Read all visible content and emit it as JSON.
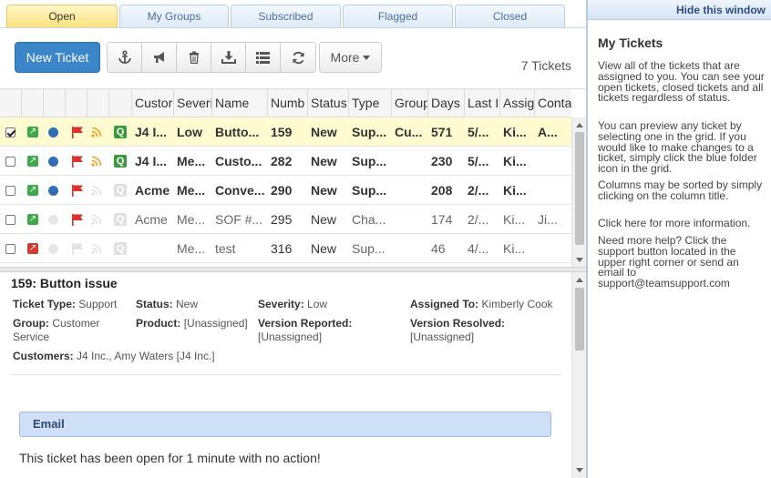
{
  "tabs": [
    {
      "label": "Open",
      "active": true
    },
    {
      "label": "My Groups",
      "active": false
    },
    {
      "label": "Subscribed",
      "active": false
    },
    {
      "label": "Flagged",
      "active": false
    },
    {
      "label": "Closed",
      "active": false
    }
  ],
  "toolbar": {
    "new_ticket_label": "New Ticket",
    "icons": [
      "anchor-icon",
      "megaphone-icon",
      "trash-icon",
      "download-icon",
      "list-icon",
      "refresh-icon"
    ],
    "more_label": "More",
    "ticket_count": "7 Tickets"
  },
  "grid": {
    "headers": [
      "Custor",
      "Severi",
      "Name",
      "Numb",
      "Status",
      "Type",
      "Group",
      "Days",
      "Last I",
      "Assig",
      "Conta"
    ],
    "rows": [
      {
        "checked": true,
        "dot": "blue",
        "flag": true,
        "rss_active": true,
        "q_active": true,
        "arrow": "green",
        "bold": true,
        "cells": [
          "J4 I...",
          "Low",
          "Butto...",
          "159",
          "New",
          "Sup...",
          "Cu...",
          "571",
          "5/...",
          "Ki...",
          "A..."
        ]
      },
      {
        "checked": false,
        "dot": "blue",
        "flag": true,
        "rss_active": true,
        "q_active": true,
        "arrow": "green",
        "bold": true,
        "cells": [
          "J4 I...",
          "Me...",
          "Custo...",
          "282",
          "New",
          "Sup...",
          "",
          "230",
          "5/...",
          "Ki...",
          ""
        ]
      },
      {
        "checked": false,
        "dot": "blue",
        "flag": true,
        "rss_active": false,
        "q_active": false,
        "arrow": "green",
        "bold": true,
        "cells": [
          "Acme",
          "Me...",
          "Conve...",
          "290",
          "New",
          "Sup...",
          "",
          "208",
          "2/...",
          "Ki...",
          ""
        ]
      },
      {
        "checked": false,
        "dot": "off",
        "flag": true,
        "rss_active": false,
        "q_active": false,
        "arrow": "green",
        "bold": false,
        "cells": [
          "Acme",
          "Me...",
          "SOF #...",
          "295",
          "New",
          "Cha...",
          "",
          "174",
          "2/...",
          "Ki...",
          "Ji..."
        ]
      },
      {
        "checked": false,
        "dot": "off",
        "flag": false,
        "rss_active": false,
        "q_active": false,
        "arrow": "red",
        "bold": false,
        "cells": [
          "",
          "Me...",
          "test",
          "316",
          "New",
          "Sup...",
          "",
          "46",
          "4/...",
          "Ki...",
          ""
        ]
      }
    ]
  },
  "detail": {
    "title": "159: Button issue",
    "ticket_type_label": "Ticket Type:",
    "ticket_type": "Support",
    "status_label": "Status:",
    "status": "New",
    "severity_label": "Severity:",
    "severity": "Low",
    "assigned_label": "Assigned To:",
    "assigned": "Kimberly Cook",
    "group_label": "Group:",
    "group_line1": "Customer",
    "group_line2": "Service",
    "product_label": "Product:",
    "product": "[Unassigned]",
    "version_reported_label": "Version Reported:",
    "version_reported": "[Unassigned]",
    "version_resolved_label": "Version Resolved:",
    "version_resolved": "[Unassigned]",
    "customers_label": "Customers:",
    "customers": "J4 Inc., Amy Waters [J4 Inc.]",
    "email_label": "Email",
    "no_action_text": "This ticket has been open for 1 minute with no action!"
  },
  "right_panel": {
    "hide_link": "Hide this window",
    "title": "My Tickets",
    "para1": "View all of the tickets that are assigned to you. You can see your open tickets, closed tickets and all tickets regardless of status.",
    "para2": "You can preview any ticket by selecting one in the grid. If you would like to make changes to a ticket, simply click the blue folder icon in the grid.",
    "para3": "Columns may be sorted by simply clicking on the column title.",
    "para4": "Click here for more information.",
    "para5": "Need more help? Click the support button located in the upper right corner or send an email to support@teamsupport.com"
  }
}
